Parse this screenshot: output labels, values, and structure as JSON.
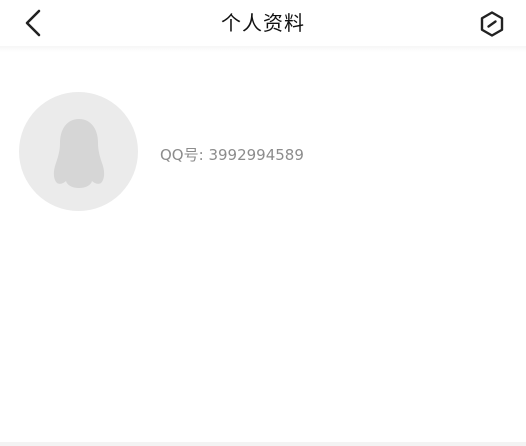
{
  "header": {
    "title": "个人资料",
    "back_icon": "chevron-left-icon",
    "menu_icon": "hexagon-more-icon"
  },
  "profile": {
    "avatar_icon": "penguin-placeholder-icon",
    "qq_label": "QQ号:",
    "qq_number": "3992994589"
  },
  "colors": {
    "background": "#ffffff",
    "avatar_bg": "#ebebeb",
    "avatar_fg": "#d6d6d6",
    "secondary_text": "#8c8c8c"
  }
}
